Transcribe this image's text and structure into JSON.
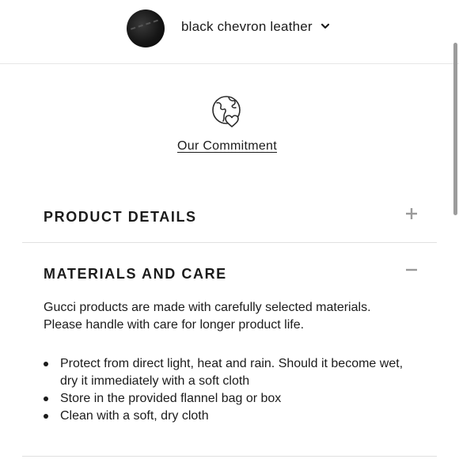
{
  "variant": {
    "swatch_icon": "black-chevron-leather-swatch",
    "label": "black chevron leather",
    "dropdown_icon": "chevron-down-icon"
  },
  "commitment": {
    "icon": "globe-heart-icon",
    "link_label": "Our Commitment"
  },
  "accordion": {
    "product_details": {
      "title": "PRODUCT DETAILS",
      "toggle_icon": "plus-icon",
      "expanded": false
    },
    "materials_care": {
      "title": "MATERIALS AND CARE",
      "toggle_icon": "minus-icon",
      "expanded": true,
      "intro_line1": "Gucci products are made with carefully selected materials.",
      "intro_line2": "Please handle with care for longer product life.",
      "items": [
        "Protect from direct light, heat and rain. Should it become wet, dry it immediately with a soft cloth",
        "Store in the provided flannel bag or box",
        "Clean with a soft, dry cloth"
      ]
    }
  },
  "colors": {
    "text": "#1b1b1b",
    "divider": "#e0e0e0",
    "toggle": "#9a9a9a"
  }
}
